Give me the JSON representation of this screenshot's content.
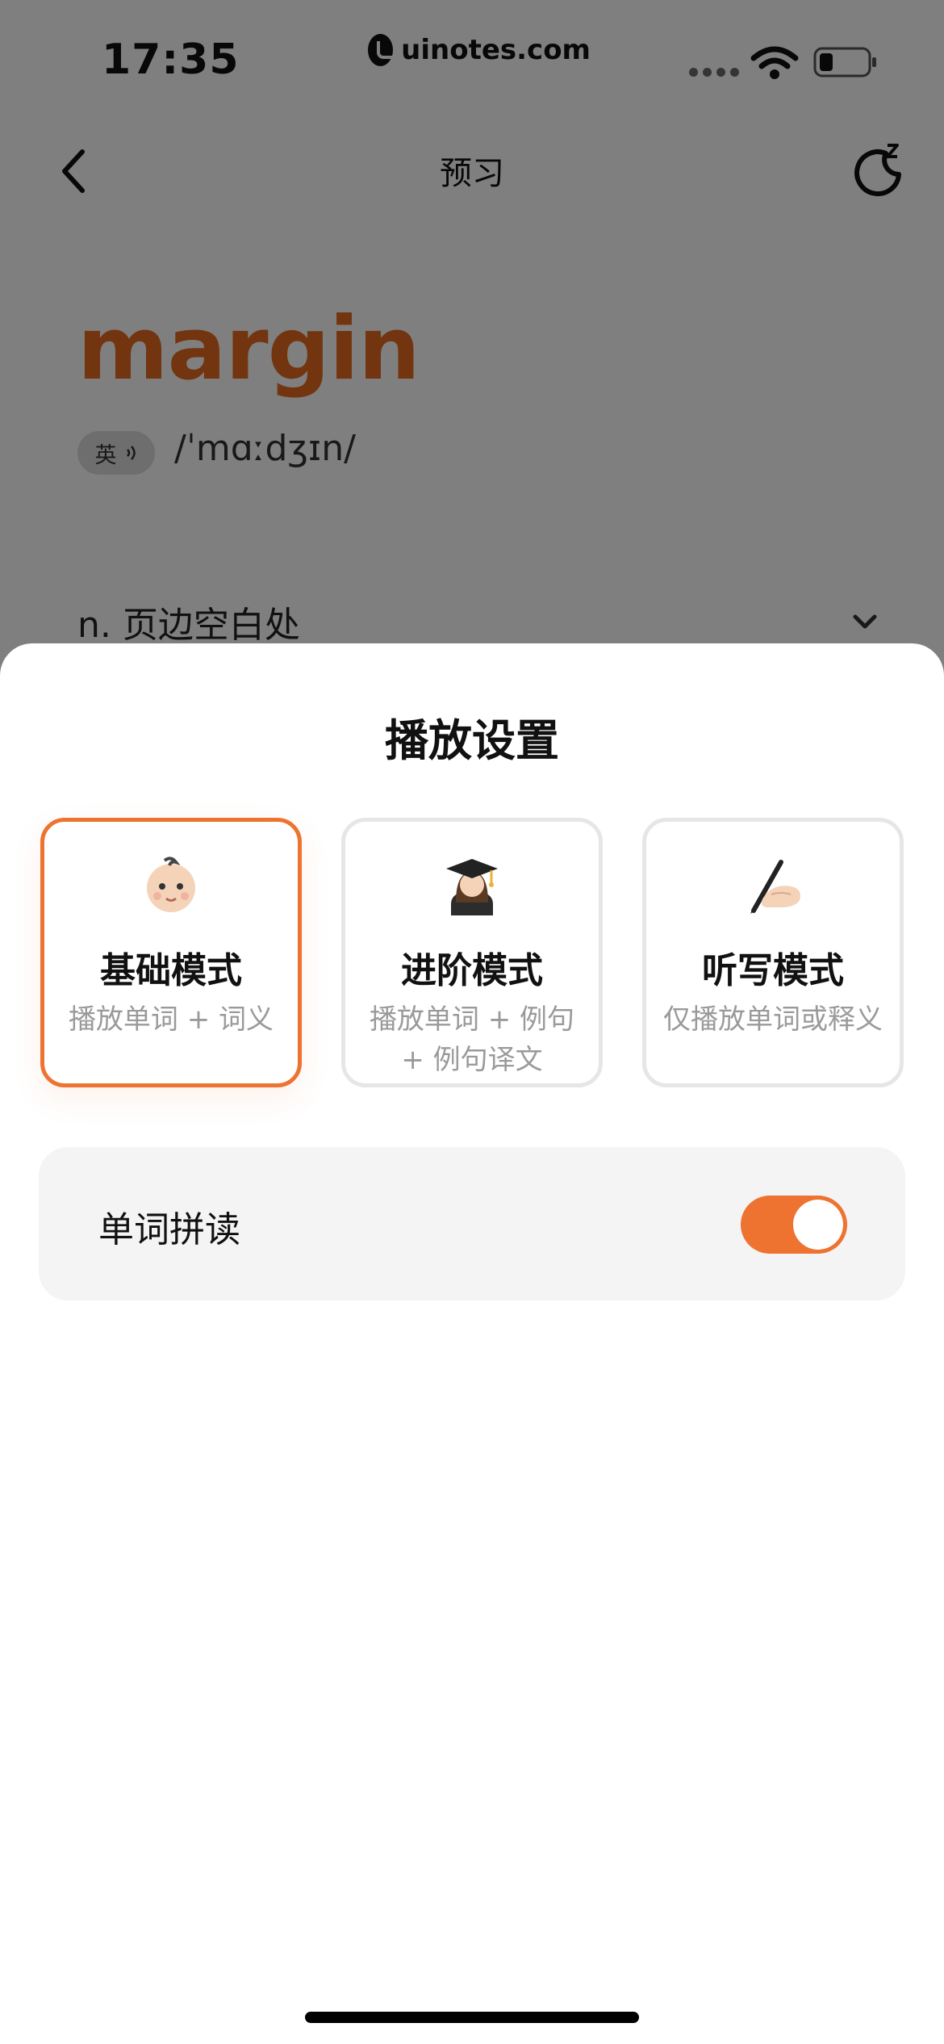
{
  "status_bar": {
    "time": "17:35",
    "watermark": "uinotes.com"
  },
  "nav": {
    "title": "预习"
  },
  "word_card": {
    "word": "margin",
    "accent": "英",
    "phonetic": "/ˈmɑːdʒɪn/",
    "definition": "n. 页边空白处"
  },
  "sheet": {
    "title": "播放设置",
    "modes": [
      {
        "emoji": "baby",
        "name": "基础模式",
        "description": "播放单词 + 词义",
        "selected": true
      },
      {
        "emoji": "graduate",
        "name": "进阶模式",
        "description": "播放单词 + 例句 + 例句译文",
        "selected": false
      },
      {
        "emoji": "writing-hand",
        "name": "听写模式",
        "description": "仅播放单词或释义",
        "selected": false
      }
    ],
    "spelling": {
      "label": "单词拼读",
      "enabled": true
    }
  },
  "colors": {
    "accent": "#ee7330",
    "word": "#e56a1f"
  }
}
